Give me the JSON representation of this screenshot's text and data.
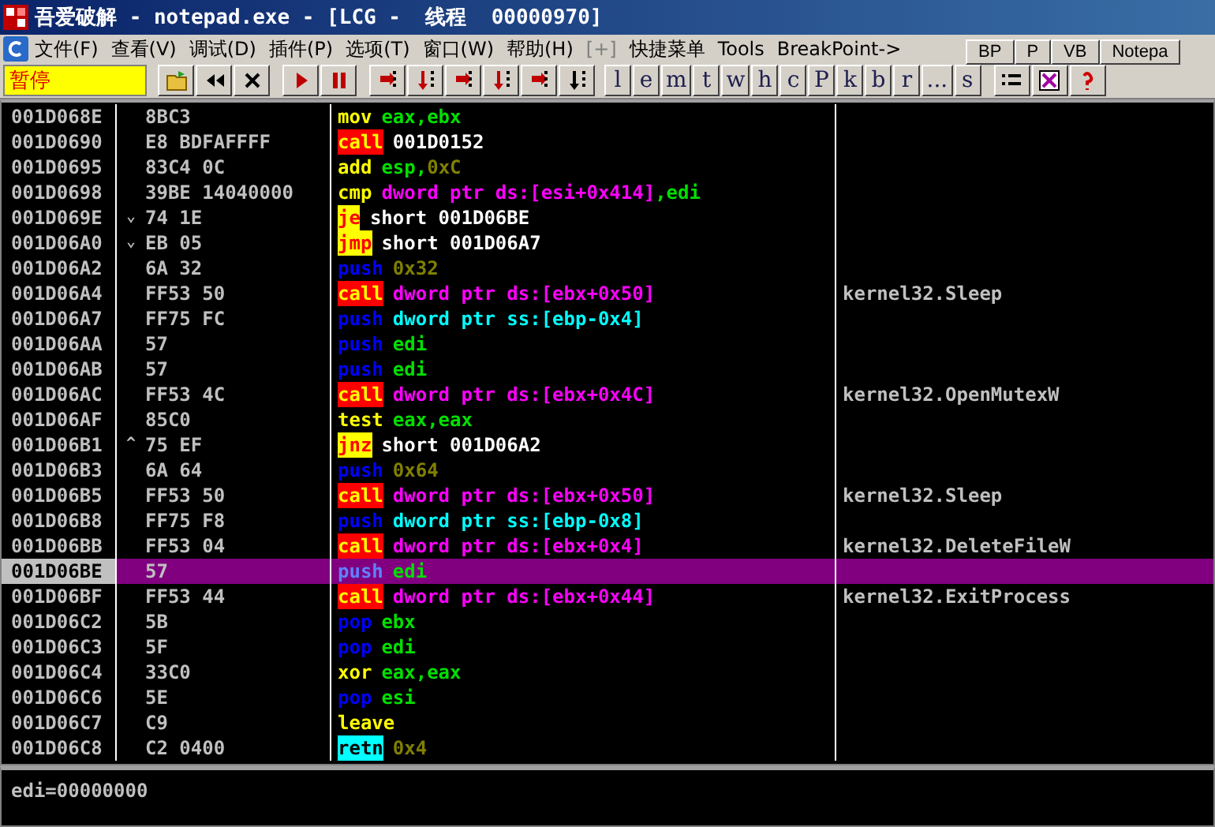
{
  "window": {
    "title": "吾爱破解 - notepad.exe - [LCG -  线程  00000970]"
  },
  "menu": [
    {
      "label": "文件(F)",
      "disabled": false
    },
    {
      "label": "查看(V)",
      "disabled": false
    },
    {
      "label": "调试(D)",
      "disabled": false
    },
    {
      "label": "插件(P)",
      "disabled": false
    },
    {
      "label": "选项(T)",
      "disabled": false
    },
    {
      "label": "窗口(W)",
      "disabled": false
    },
    {
      "label": "帮助(H)",
      "disabled": false
    },
    {
      "label": "[+]",
      "disabled": true
    },
    {
      "label": "快捷菜单",
      "disabled": false
    },
    {
      "label": "Tools",
      "disabled": false
    },
    {
      "label": "BreakPoint->",
      "disabled": false
    }
  ],
  "status": "暂停",
  "letter_buttons": [
    "l",
    "e",
    "m",
    "t",
    "w",
    "h",
    "c",
    "P",
    "k",
    "b",
    "r",
    "...",
    "s"
  ],
  "plugin_toolbar": [
    "BP",
    "P",
    "VB",
    "Notepa"
  ],
  "rows": [
    {
      "address": "001D068E",
      "bytes": "8BC3",
      "mnemonic": "mov",
      "kind": "plain",
      "operands": [
        {
          "t": "eax,ebx",
          "kind": "reg"
        }
      ],
      "selected": false
    },
    {
      "address": "001D0690",
      "bytes": "E8 BDFAFFFF",
      "mnemonic": "call",
      "kind": "call",
      "operands": [
        {
          "t": "001D0152",
          "kind": "addr"
        }
      ],
      "selected": false
    },
    {
      "address": "001D0695",
      "bytes": "83C4 0C",
      "mnemonic": "add",
      "kind": "plain",
      "operands": [
        {
          "t": "esp,",
          "kind": "reg"
        },
        {
          "t": "0xC",
          "kind": "const"
        }
      ],
      "selected": false
    },
    {
      "address": "001D0698",
      "bytes": "39BE 14040000",
      "mnemonic": "cmp",
      "kind": "plain",
      "operands": [
        {
          "t": "dword ptr ds:[esi+0x414]",
          "kind": "mem"
        },
        {
          "t": ",edi",
          "kind": "reg"
        }
      ],
      "selected": false
    },
    {
      "address": "001D069E",
      "jump": "⌄",
      "bytes": "74 1E",
      "mnemonic": "je",
      "kind": "jump",
      "operands": [
        {
          "t": "short 001D06BE",
          "kind": "addr"
        }
      ],
      "selected": false
    },
    {
      "address": "001D06A0",
      "jump": "⌄",
      "bytes": "EB 05",
      "mnemonic": "jmp",
      "kind": "jump",
      "operands": [
        {
          "t": "short 001D06A7",
          "kind": "addr"
        }
      ],
      "selected": false
    },
    {
      "address": "001D06A2",
      "bytes": "6A 32",
      "mnemonic": "push",
      "kind": "stack",
      "operands": [
        {
          "t": "0x32",
          "kind": "const"
        }
      ],
      "selected": false
    },
    {
      "address": "001D06A4",
      "bytes": "FF53 50",
      "mnemonic": "call",
      "kind": "call",
      "operands": [
        {
          "t": "dword ptr ds:[ebx+0x50]",
          "kind": "mem"
        }
      ],
      "comment": "kernel32.Sleep",
      "selected": false
    },
    {
      "address": "001D06A7",
      "bytes": "FF75 FC",
      "mnemonic": "push",
      "kind": "stack",
      "operands": [
        {
          "t": "dword ptr ss:[ebp-0x4]",
          "kind": "ss"
        }
      ],
      "selected": false
    },
    {
      "address": "001D06AA",
      "bytes": "57",
      "mnemonic": "push",
      "kind": "stack",
      "operands": [
        {
          "t": "edi",
          "kind": "reg"
        }
      ],
      "selected": false
    },
    {
      "address": "001D06AB",
      "bytes": "57",
      "mnemonic": "push",
      "kind": "stack",
      "operands": [
        {
          "t": "edi",
          "kind": "reg"
        }
      ],
      "selected": false
    },
    {
      "address": "001D06AC",
      "bytes": "FF53 4C",
      "mnemonic": "call",
      "kind": "call",
      "operands": [
        {
          "t": "dword ptr ds:[ebx+0x4C]",
          "kind": "mem"
        }
      ],
      "comment": "kernel32.OpenMutexW",
      "selected": false
    },
    {
      "address": "001D06AF",
      "bytes": "85C0",
      "mnemonic": "test",
      "kind": "plain",
      "operands": [
        {
          "t": "eax,eax",
          "kind": "reg"
        }
      ],
      "selected": false
    },
    {
      "address": "001D06B1",
      "jump": "^",
      "bytes": "75 EF",
      "mnemonic": "jnz",
      "kind": "jump",
      "operands": [
        {
          "t": "short 001D06A2",
          "kind": "addr"
        }
      ],
      "selected": false
    },
    {
      "address": "001D06B3",
      "bytes": "6A 64",
      "mnemonic": "push",
      "kind": "stack",
      "operands": [
        {
          "t": "0x64",
          "kind": "const"
        }
      ],
      "selected": false
    },
    {
      "address": "001D06B5",
      "bytes": "FF53 50",
      "mnemonic": "call",
      "kind": "call",
      "operands": [
        {
          "t": "dword ptr ds:[ebx+0x50]",
          "kind": "mem"
        }
      ],
      "comment": "kernel32.Sleep",
      "selected": false
    },
    {
      "address": "001D06B8",
      "bytes": "FF75 F8",
      "mnemonic": "push",
      "kind": "stack",
      "operands": [
        {
          "t": "dword ptr ss:[ebp-0x8]",
          "kind": "ss"
        }
      ],
      "selected": false
    },
    {
      "address": "001D06BB",
      "bytes": "FF53 04",
      "mnemonic": "call",
      "kind": "call",
      "operands": [
        {
          "t": "dword ptr ds:[ebx+0x4]",
          "kind": "mem"
        }
      ],
      "comment": "kernel32.DeleteFileW",
      "selected": false
    },
    {
      "address": "001D06BE",
      "bytes": "57",
      "mnemonic": "push",
      "kind": "stack",
      "operands": [
        {
          "t": "edi",
          "kind": "reg"
        }
      ],
      "selected": true
    },
    {
      "address": "001D06BF",
      "bytes": "FF53 44",
      "mnemonic": "call",
      "kind": "call",
      "operands": [
        {
          "t": "dword ptr ds:[ebx+0x44]",
          "kind": "mem"
        }
      ],
      "comment": "kernel32.ExitProcess",
      "selected": false
    },
    {
      "address": "001D06C2",
      "bytes": "5B",
      "mnemonic": "pop",
      "kind": "stack",
      "operands": [
        {
          "t": "ebx",
          "kind": "reg"
        }
      ],
      "selected": false
    },
    {
      "address": "001D06C3",
      "bytes": "5F",
      "mnemonic": "pop",
      "kind": "stack",
      "operands": [
        {
          "t": "edi",
          "kind": "reg"
        }
      ],
      "selected": false
    },
    {
      "address": "001D06C4",
      "bytes": "33C0",
      "mnemonic": "xor",
      "kind": "plain",
      "operands": [
        {
          "t": "eax,eax",
          "kind": "reg"
        }
      ],
      "selected": false
    },
    {
      "address": "001D06C6",
      "bytes": "5E",
      "mnemonic": "pop",
      "kind": "stack",
      "operands": [
        {
          "t": "esi",
          "kind": "reg"
        }
      ],
      "selected": false
    },
    {
      "address": "001D06C7",
      "bytes": "C9",
      "mnemonic": "leave",
      "kind": "plain",
      "operands": [],
      "selected": false
    },
    {
      "address": "001D06C8",
      "bytes": "C2 0400",
      "mnemonic": "retn",
      "kind": "ret",
      "operands": [
        {
          "t": "0x4",
          "kind": "const"
        }
      ],
      "selected": false
    }
  ],
  "info": "edi=00000000"
}
